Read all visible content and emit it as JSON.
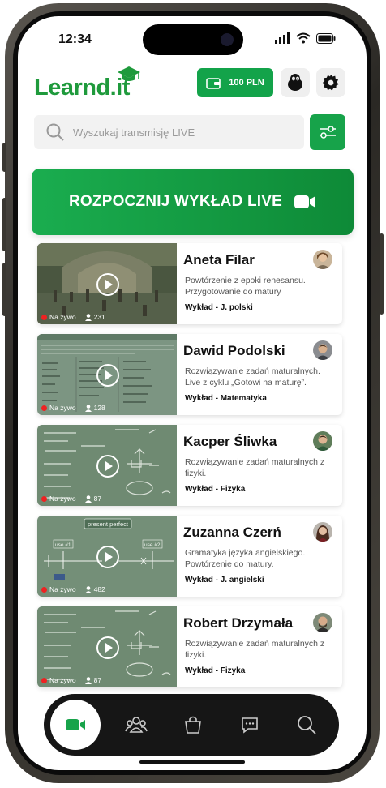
{
  "status_bar": {
    "time": "12:34"
  },
  "header": {
    "logo": "Learnd.it",
    "balance": "100 PLN",
    "icons": [
      "wallet-icon",
      "mascot-icon",
      "gear-icon"
    ]
  },
  "search": {
    "placeholder": "Wyszukaj transmisję LIVE"
  },
  "live_button": {
    "label": "ROZPOCZNIJ WYKŁAD LIVE"
  },
  "live_label": "Na żywo",
  "streams": [
    {
      "name": "Aneta Filar",
      "description": "Powtórzenie z epoki renesansu. Przygotowanie do matury",
      "category": "Wykład - J. polski",
      "viewers": "231",
      "thumb": "renaissance-painting"
    },
    {
      "name": "Dawid Podolski",
      "description": "Rozwiązywanie zadań maturalnych. Live z cyklu „Gotowi na maturę”.",
      "category": "Wykład - Matematyka",
      "viewers": "128",
      "thumb": "math-sheet"
    },
    {
      "name": "Kacper Śliwka",
      "description": "Rozwiązywanie zadań maturalnych z fizyki.",
      "category": "Wykład - Fizyka",
      "viewers": "87",
      "thumb": "physics-board"
    },
    {
      "name": "Zuzanna Czerń",
      "description": "Gramatyka języka angielskiego. Powtórzenie do matury.",
      "category": "Wykład - J. angielski",
      "viewers": "482",
      "thumb": "english-board"
    },
    {
      "name": "Robert Drzymała",
      "description": "Rozwiązywanie zadań maturalnych z fizyki.",
      "category": "Wykład - Fizyka",
      "viewers": "87",
      "thumb": "physics-board"
    }
  ],
  "thumb_text": {
    "present_perfect": "present perfect",
    "use1": "use #1",
    "use2": "use #2"
  },
  "tabbar": [
    "video-icon",
    "community-icon",
    "shop-icon",
    "chat-icon",
    "search-icon"
  ],
  "colors": {
    "brand": "#1f9a3c",
    "button": "#13a34a",
    "tabbar": "#161616",
    "live_dot": "#e22222"
  }
}
